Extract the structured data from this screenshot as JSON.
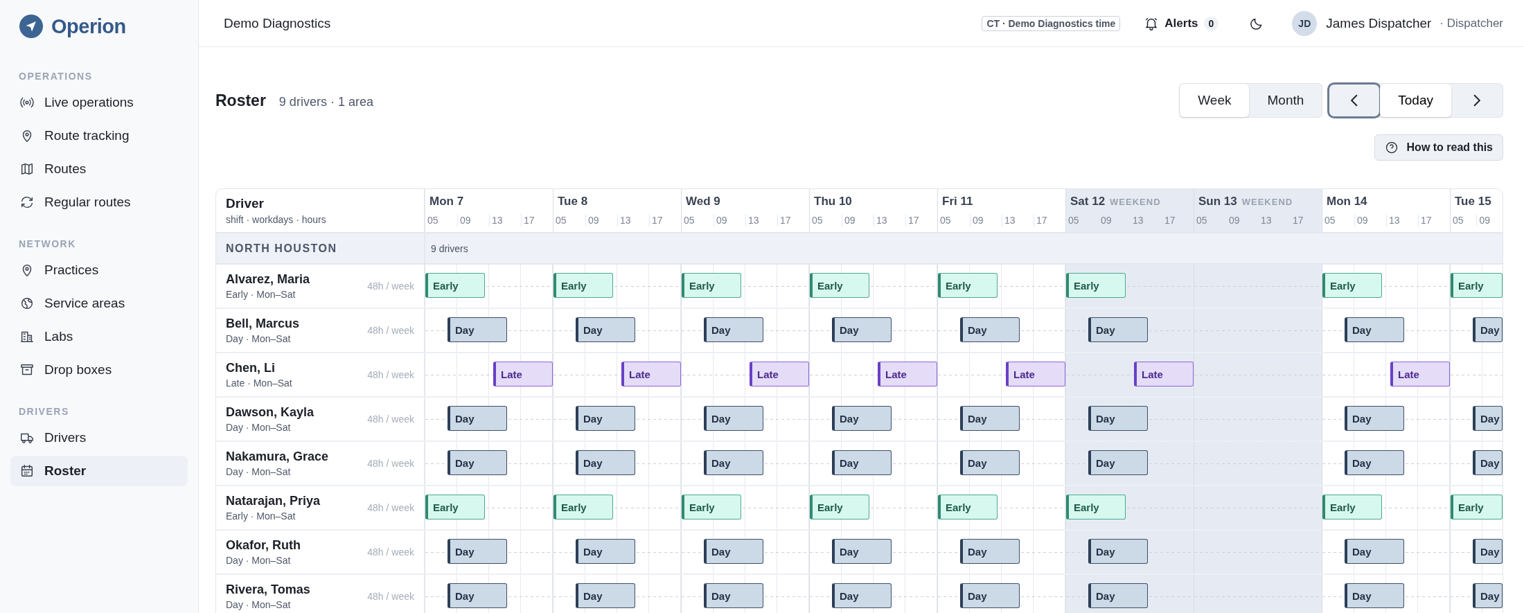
{
  "app": {
    "name": "Operion"
  },
  "sidebar": {
    "sections": [
      {
        "label": "OPERATIONS",
        "items": [
          {
            "label": "Live operations",
            "selected": false
          },
          {
            "label": "Route tracking",
            "selected": false
          },
          {
            "label": "Routes",
            "selected": false
          },
          {
            "label": "Regular routes",
            "selected": false
          }
        ]
      },
      {
        "label": "NETWORK",
        "items": [
          {
            "label": "Practices",
            "selected": false
          },
          {
            "label": "Service areas",
            "selected": false
          },
          {
            "label": "Labs",
            "selected": false
          },
          {
            "label": "Drop boxes",
            "selected": false
          }
        ]
      },
      {
        "label": "DRIVERS",
        "items": [
          {
            "label": "Drivers",
            "selected": false
          },
          {
            "label": "Roster",
            "selected": true
          }
        ]
      }
    ]
  },
  "header": {
    "org": "Demo Diagnostics",
    "timezone": "CT · Demo Diagnostics time",
    "alerts": {
      "label": "Alerts",
      "count": "0"
    },
    "user": {
      "initials": "JD",
      "name": "James Dispatcher",
      "role": "· Dispatcher"
    }
  },
  "page": {
    "title": "Roster",
    "summary": "9 drivers · 1 area",
    "views": [
      {
        "label": "Week",
        "selected": true
      },
      {
        "label": "Month",
        "selected": false
      }
    ],
    "nav": {
      "prev_focused": true,
      "today": "Today"
    },
    "help": "How to read this"
  },
  "roster": {
    "driver_heading": "Driver",
    "driver_subheading": "shift · workdays · hours",
    "days": [
      {
        "label": "Mon 7",
        "weekend": false,
        "ticks": [
          "05",
          "09",
          "13",
          "17"
        ]
      },
      {
        "label": "Tue 8",
        "weekend": false,
        "ticks": [
          "05",
          "09",
          "13",
          "17"
        ]
      },
      {
        "label": "Wed 9",
        "weekend": false,
        "ticks": [
          "05",
          "09",
          "13",
          "17"
        ]
      },
      {
        "label": "Thu 10",
        "weekend": false,
        "ticks": [
          "05",
          "09",
          "13",
          "17"
        ]
      },
      {
        "label": "Fri 11",
        "weekend": false,
        "ticks": [
          "05",
          "09",
          "13",
          "17"
        ]
      },
      {
        "label": "Sat 12",
        "tag": "WEEKEND",
        "weekend": true,
        "ticks": [
          "05",
          "09",
          "13",
          "17"
        ]
      },
      {
        "label": "Sun 13",
        "tag": "WEEKEND",
        "weekend": true,
        "ticks": [
          "05",
          "09",
          "13",
          "17"
        ]
      },
      {
        "label": "Mon 14",
        "weekend": false,
        "ticks": [
          "05",
          "09",
          "13",
          "17"
        ]
      },
      {
        "label": "Tue 15",
        "weekend": false,
        "ticks": [
          "05",
          "09"
        ]
      }
    ],
    "areas": [
      {
        "name": "NORTH HOUSTON",
        "count": "9 drivers",
        "drivers": [
          {
            "name": "Alvarez, Maria",
            "detail": "Early · Mon–Sat",
            "hours": "48h / week",
            "shifts": [
              {
                "kind": "early",
                "label": "Early"
              },
              {
                "kind": "early",
                "label": "Early"
              },
              {
                "kind": "early",
                "label": "Early"
              },
              {
                "kind": "early",
                "label": "Early"
              },
              {
                "kind": "early",
                "label": "Early"
              },
              {
                "kind": "early",
                "label": "Early"
              },
              {
                "kind": "off"
              },
              {
                "kind": "early",
                "label": "Early"
              },
              {
                "kind": "early",
                "label": "Early"
              }
            ]
          },
          {
            "name": "Bell, Marcus",
            "detail": "Day · Mon–Sat",
            "hours": "48h / week",
            "shifts": [
              {
                "kind": "day",
                "label": "Day"
              },
              {
                "kind": "day",
                "label": "Day"
              },
              {
                "kind": "day",
                "label": "Day"
              },
              {
                "kind": "day",
                "label": "Day"
              },
              {
                "kind": "day",
                "label": "Day"
              },
              {
                "kind": "day",
                "label": "Day"
              },
              {
                "kind": "off"
              },
              {
                "kind": "day",
                "label": "Day"
              },
              {
                "kind": "day",
                "label": "Day"
              }
            ]
          },
          {
            "name": "Chen, Li",
            "detail": "Late · Mon–Sat",
            "hours": "48h / week",
            "shifts": [
              {
                "kind": "late",
                "label": "Late"
              },
              {
                "kind": "late",
                "label": "Late"
              },
              {
                "kind": "late",
                "label": "Late"
              },
              {
                "kind": "late",
                "label": "Late"
              },
              {
                "kind": "late",
                "label": "Late"
              },
              {
                "kind": "late",
                "label": "Late"
              },
              {
                "kind": "off"
              },
              {
                "kind": "late",
                "label": "Late"
              },
              {
                "kind": "off"
              }
            ]
          },
          {
            "name": "Dawson, Kayla",
            "detail": "Day · Mon–Sat",
            "hours": "48h / week",
            "shifts": [
              {
                "kind": "day",
                "label": "Day"
              },
              {
                "kind": "day",
                "label": "Day"
              },
              {
                "kind": "day",
                "label": "Day"
              },
              {
                "kind": "day",
                "label": "Day"
              },
              {
                "kind": "day",
                "label": "Day"
              },
              {
                "kind": "day",
                "label": "Day"
              },
              {
                "kind": "off"
              },
              {
                "kind": "day",
                "label": "Day"
              },
              {
                "kind": "day",
                "label": "Day"
              }
            ]
          },
          {
            "name": "Nakamura, Grace",
            "detail": "Day · Mon–Sat",
            "hours": "48h / week",
            "shifts": [
              {
                "kind": "day",
                "label": "Day"
              },
              {
                "kind": "day",
                "label": "Day"
              },
              {
                "kind": "day",
                "label": "Day"
              },
              {
                "kind": "day",
                "label": "Day"
              },
              {
                "kind": "day",
                "label": "Day"
              },
              {
                "kind": "day",
                "label": "Day"
              },
              {
                "kind": "off"
              },
              {
                "kind": "day",
                "label": "Day"
              },
              {
                "kind": "day",
                "label": "Day"
              }
            ]
          },
          {
            "name": "Natarajan, Priya",
            "detail": "Early · Mon–Sat",
            "hours": "48h / week",
            "shifts": [
              {
                "kind": "early",
                "label": "Early"
              },
              {
                "kind": "early",
                "label": "Early"
              },
              {
                "kind": "early",
                "label": "Early"
              },
              {
                "kind": "early",
                "label": "Early"
              },
              {
                "kind": "early",
                "label": "Early"
              },
              {
                "kind": "early",
                "label": "Early"
              },
              {
                "kind": "off"
              },
              {
                "kind": "early",
                "label": "Early"
              },
              {
                "kind": "early",
                "label": "Early"
              }
            ]
          },
          {
            "name": "Okafor, Ruth",
            "detail": "Day · Mon–Sat",
            "hours": "48h / week",
            "shifts": [
              {
                "kind": "day",
                "label": "Day"
              },
              {
                "kind": "day",
                "label": "Day"
              },
              {
                "kind": "day",
                "label": "Day"
              },
              {
                "kind": "day",
                "label": "Day"
              },
              {
                "kind": "day",
                "label": "Day"
              },
              {
                "kind": "day",
                "label": "Day"
              },
              {
                "kind": "off"
              },
              {
                "kind": "day",
                "label": "Day"
              },
              {
                "kind": "day",
                "label": "Day"
              }
            ]
          },
          {
            "name": "Rivera, Tomas",
            "detail": "Day · Mon–Sat",
            "hours": "48h / week",
            "shifts": [
              {
                "kind": "day",
                "label": "Day"
              },
              {
                "kind": "day",
                "label": "Day"
              },
              {
                "kind": "day",
                "label": "Day"
              },
              {
                "kind": "day",
                "label": "Day"
              },
              {
                "kind": "day",
                "label": "Day"
              },
              {
                "kind": "day",
                "label": "Day"
              },
              {
                "kind": "off"
              },
              {
                "kind": "day",
                "label": "Day"
              },
              {
                "kind": "day",
                "label": "Day"
              }
            ]
          }
        ]
      }
    ]
  }
}
